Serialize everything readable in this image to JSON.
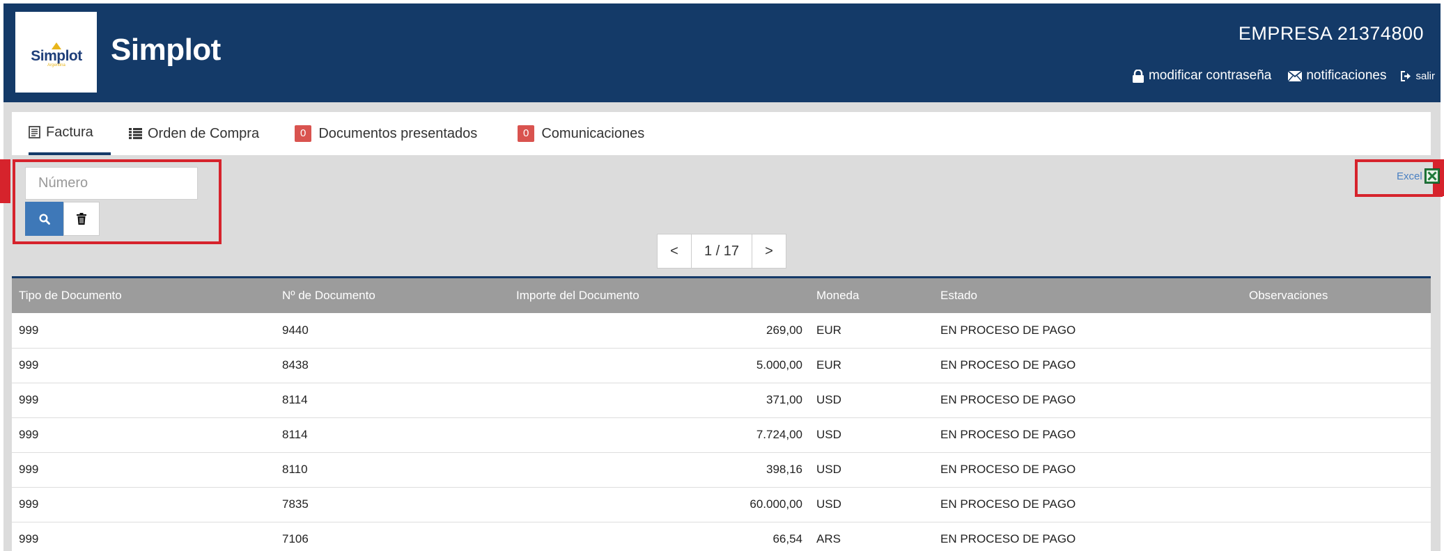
{
  "header": {
    "logo_text": "Simplot",
    "logo_subtext": "Argentina",
    "brand": "Simplot",
    "company": "EMPRESA 21374800",
    "links": {
      "change_password": "modificar contraseña",
      "notifications": "notificaciones",
      "logout": "salir"
    }
  },
  "tabs": [
    {
      "label": "Factura",
      "icon": "invoice-icon",
      "active": true
    },
    {
      "label": "Orden de Compra",
      "icon": "list-icon",
      "active": false
    },
    {
      "label": "Documentos presentados",
      "badge": "0",
      "active": false
    },
    {
      "label": "Comunicaciones",
      "badge": "0",
      "active": false
    }
  ],
  "filter": {
    "number_placeholder": "Número"
  },
  "export": {
    "label": "Excel"
  },
  "pagination": {
    "prev": "<",
    "current": "1 / 17",
    "next": ">"
  },
  "table": {
    "columns": [
      "Tipo de Documento",
      "Nº de Documento",
      "Importe del Documento",
      "Moneda",
      "Estado",
      "Observaciones"
    ],
    "rows": [
      [
        "999",
        "9440",
        "269,00",
        "EUR",
        "EN PROCESO DE PAGO",
        ""
      ],
      [
        "999",
        "8438",
        "5.000,00",
        "EUR",
        "EN PROCESO DE PAGO",
        ""
      ],
      [
        "999",
        "8114",
        "371,00",
        "USD",
        "EN PROCESO DE PAGO",
        ""
      ],
      [
        "999",
        "8114",
        "7.724,00",
        "USD",
        "EN PROCESO DE PAGO",
        ""
      ],
      [
        "999",
        "8110",
        "398,16",
        "USD",
        "EN PROCESO DE PAGO",
        ""
      ],
      [
        "999",
        "7835",
        "60.000,00",
        "USD",
        "EN PROCESO DE PAGO",
        ""
      ],
      [
        "999",
        "7106",
        "66,54",
        "ARS",
        "EN PROCESO DE PAGO",
        ""
      ]
    ]
  },
  "colors": {
    "header_bg": "#143a68",
    "badge": "#d9534f",
    "highlight": "#d6232c",
    "search_button": "#3e78b8",
    "table_header": "#9c9c9c"
  }
}
